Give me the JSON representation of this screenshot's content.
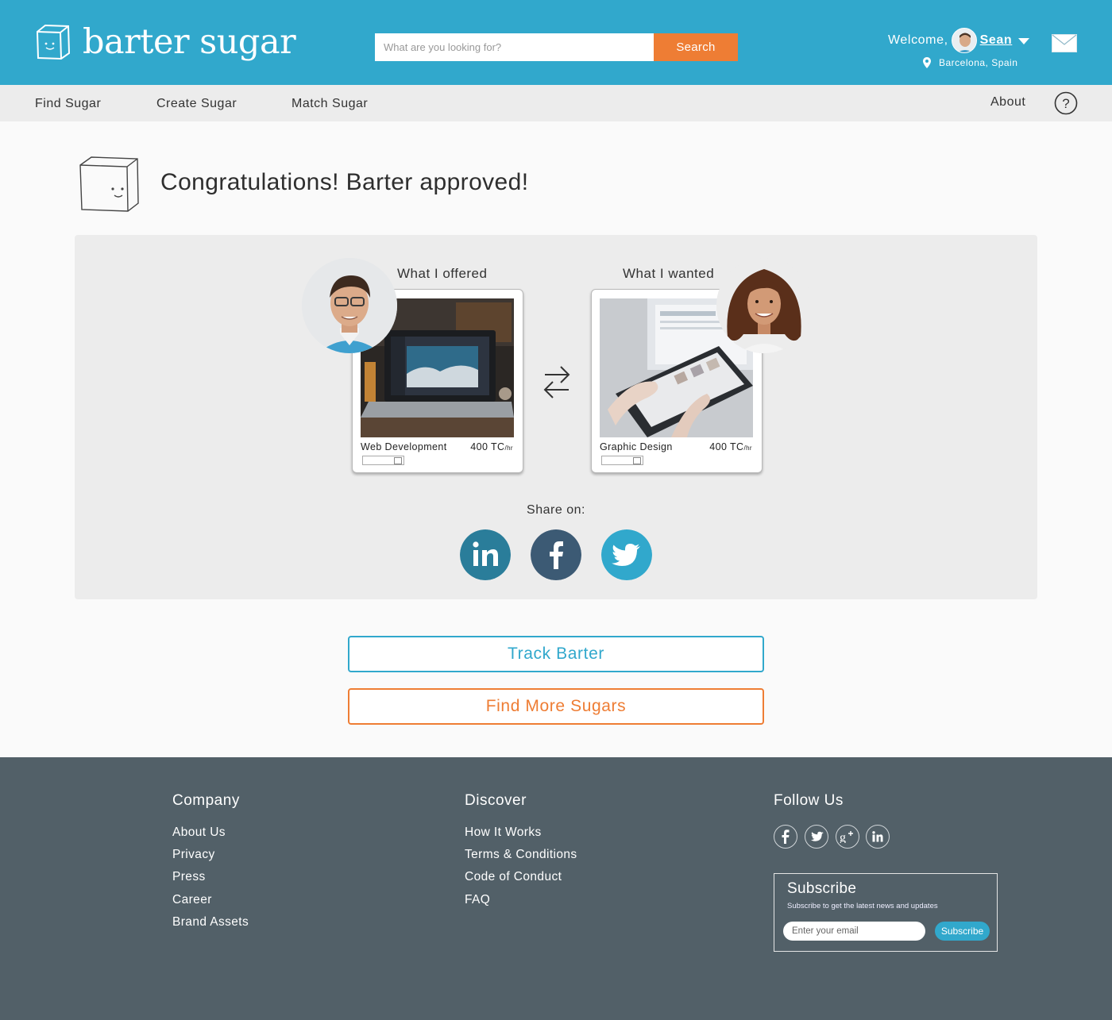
{
  "header": {
    "brand": "barter sugar",
    "search_placeholder": "What are you looking for?",
    "search_button": "Search",
    "welcome_label": "Welcome,",
    "user_name": "Sean",
    "location": "Barcelona, Spain"
  },
  "nav": {
    "items": [
      "Find Sugar",
      "Create Sugar",
      "Match Sugar"
    ],
    "about": "About"
  },
  "main": {
    "title": "Congratulations! Barter approved!",
    "offered_label": "What I offered",
    "wanted_label": "What I wanted",
    "offered": {
      "title": "Web Development",
      "rate": "400 TC",
      "unit": "/hr"
    },
    "wanted": {
      "title": "Graphic Design",
      "rate": "400 TC",
      "unit": "/hr"
    },
    "share_label": "Share on:",
    "track_button": "Track Barter",
    "find_button": "Find More Sugars"
  },
  "footer": {
    "company": {
      "heading": "Company",
      "links": [
        "About Us",
        "Privacy",
        "Press",
        "Career",
        "Brand Assets"
      ]
    },
    "discover": {
      "heading": "Discover",
      "links": [
        "How It Works",
        "Terms & Conditions",
        "Code of Conduct",
        "FAQ"
      ]
    },
    "follow_heading": "Follow Us",
    "subscribe": {
      "title": "Subscribe",
      "description": "Subscribe to get the latest news and updates",
      "placeholder": "Enter your email",
      "button": "Subscribe"
    }
  },
  "colors": {
    "brand_blue": "#31a8cc",
    "accent_orange": "#ee7d34",
    "footer_bg": "#526068",
    "linkedin": "#2a7d9a",
    "facebook": "#3c5a74",
    "twitter": "#31a8cc"
  },
  "icons": [
    "logo-cube-icon",
    "chevron-down-icon",
    "location-pin-icon",
    "mail-icon",
    "help-icon",
    "swap-arrows-icon",
    "linkedin-icon",
    "facebook-icon",
    "twitter-icon",
    "google-plus-icon",
    "calendar-icon"
  ]
}
